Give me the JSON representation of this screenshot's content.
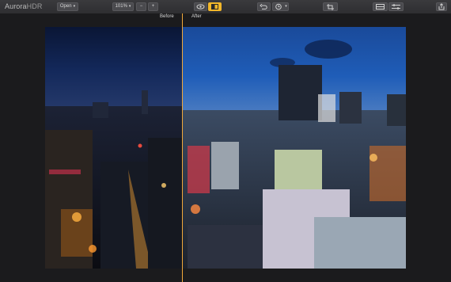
{
  "app": {
    "logo_main": "Aurora",
    "logo_suffix": "HDR"
  },
  "toolbar": {
    "open_label": "Open",
    "zoom_value": "101%",
    "zoom_out": "−",
    "zoom_in": "+"
  },
  "compare": {
    "before_label": "Before",
    "after_label": "After"
  },
  "colors": {
    "accent": "#f2b72a",
    "split_line": "#f0a83a",
    "background": "#1b1b1d",
    "toolbar": "#333336"
  }
}
